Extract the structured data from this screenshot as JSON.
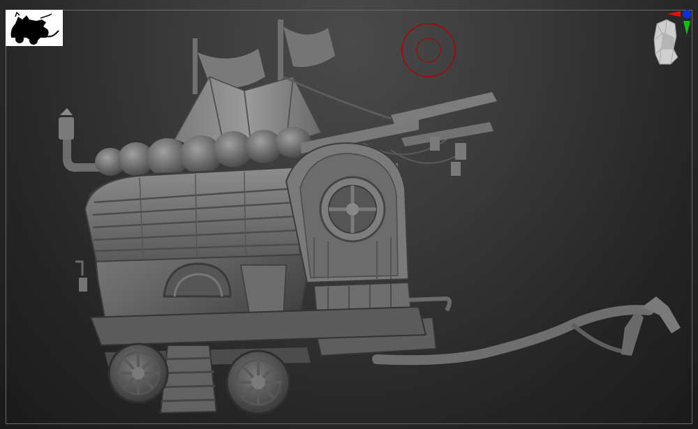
{
  "viewport": {
    "background": "#333333",
    "frame_color": "#6a6a6a",
    "model_color": "#6b6b6b"
  },
  "thumbnail": {
    "icon": "wagon-silhouette-icon",
    "background": "#ffffff",
    "fill": "#000000"
  },
  "brush": {
    "icon": "brush-cursor-icon",
    "color": "#b00000"
  },
  "navigator": {
    "icon": "head-orientation-icon",
    "axis_colors": {
      "x": "#e01010",
      "y": "#10c010",
      "z": "#1030e0"
    }
  },
  "model": {
    "icon": "gypsy-wagon-sculpt-icon"
  }
}
